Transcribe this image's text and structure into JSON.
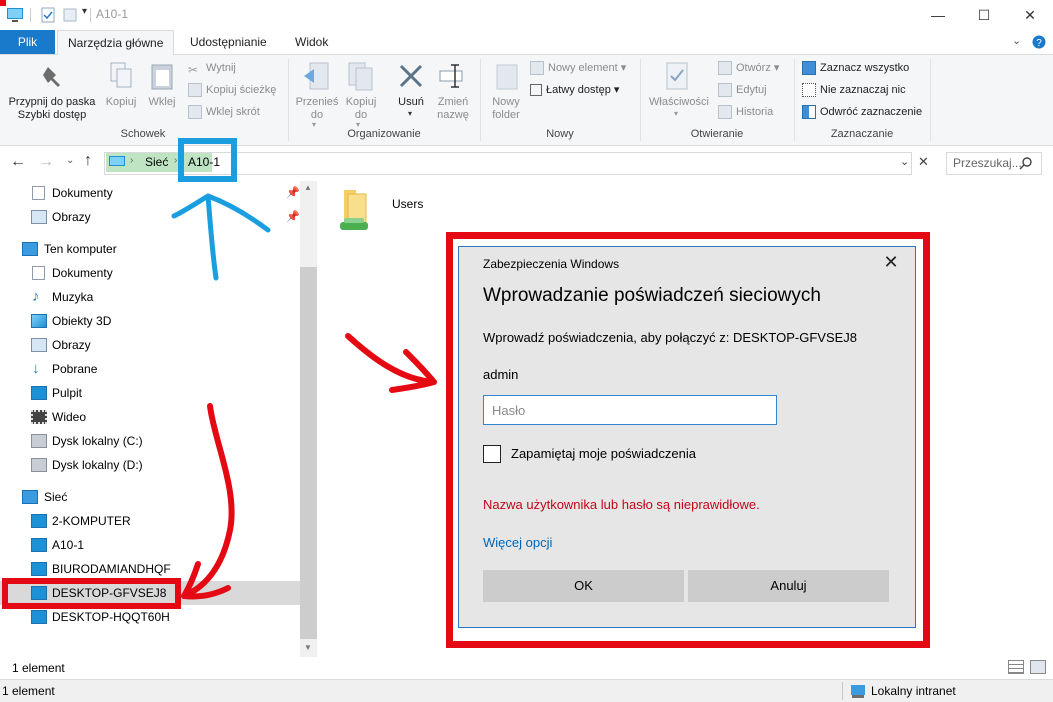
{
  "window": {
    "title": "A10-1",
    "minimize": "—",
    "maximize": "☐",
    "close": "✕"
  },
  "ribbon": {
    "tabs": [
      "Plik",
      "Narzędzia główne",
      "Udostępnianie",
      "Widok"
    ],
    "clipboard": {
      "pin_label": "Przypnij do paska Szybki dostęp",
      "copy_label": "Kopiuj",
      "paste_label": "Wklej",
      "cut_label": "Wytnij",
      "copy_path_label": "Kopiuj ścieżkę",
      "paste_shortcut_label": "Wklej skrót",
      "group_label": "Schowek"
    },
    "organize": {
      "move_label": "Przenieś do",
      "copy_to_label": "Kopiuj do",
      "delete_label": "Usuń",
      "rename_label": "Zmień nazwę",
      "group_label": "Organizowanie"
    },
    "new": {
      "new_folder_label": "Nowy folder",
      "new_item_label": "Nowy element",
      "easy_access_label": "Łatwy dostęp",
      "group_label": "Nowy"
    },
    "open": {
      "properties_label": "Właściwości",
      "open_label": "Otwórz",
      "edit_label": "Edytuj",
      "history_label": "Historia",
      "group_label": "Otwieranie"
    },
    "select": {
      "select_all_label": "Zaznacz wszystko",
      "select_none_label": "Nie zaznaczaj nic",
      "invert_label": "Odwróć zaznaczenie",
      "group_label": "Zaznaczanie"
    }
  },
  "address": {
    "crumbs": [
      "Sieć",
      "A10-1"
    ],
    "search_placeholder": "Przeszukaj..."
  },
  "nav": {
    "quick": [
      {
        "label": "Dokumenty",
        "icon": "documents-icon"
      },
      {
        "label": "Obrazy",
        "icon": "pictures-icon"
      }
    ],
    "this_pc": "Ten komputer",
    "pc_items": [
      {
        "label": "Dokumenty",
        "icon": "documents-icon"
      },
      {
        "label": "Muzyka",
        "icon": "music-icon"
      },
      {
        "label": "Obiekty 3D",
        "icon": "objects-3d-icon"
      },
      {
        "label": "Obrazy",
        "icon": "pictures-icon"
      },
      {
        "label": "Pobrane",
        "icon": "downloads-icon"
      },
      {
        "label": "Pulpit",
        "icon": "desktop-icon"
      },
      {
        "label": "Wideo",
        "icon": "video-icon"
      },
      {
        "label": "Dysk lokalny (C:)",
        "icon": "drive-icon"
      },
      {
        "label": "Dysk lokalny (D:)",
        "icon": "drive-icon"
      }
    ],
    "network": "Sieć",
    "net_items": [
      "2-KOMPUTER",
      "A10-1",
      "BIURODAMIANDHQF",
      "DESKTOP-GFVSEJ8",
      "DESKTOP-HQQT60H"
    ],
    "selected": "DESKTOP-GFVSEJ8"
  },
  "content": {
    "items": [
      {
        "label": "Users",
        "icon": "shared-folder-icon"
      }
    ]
  },
  "status": {
    "count": "1 element",
    "bottom_count": "1 element",
    "zone": "Lokalny intranet"
  },
  "dialog": {
    "title": "Zabezpieczenia Windows",
    "heading": "Wprowadzanie poświadczeń sieciowych",
    "description": "Wprowadź poświadczenia, aby połączyć z: DESKTOP-GFVSEJ8",
    "username": "admin",
    "password_placeholder": "Hasło",
    "remember_label": "Zapamiętaj moje poświadczenia",
    "error": "Nazwa użytkownika lub hasło są nieprawidłowe.",
    "more_options": "Więcej opcji",
    "ok_label": "OK",
    "cancel_label": "Anuluj",
    "close": "✕"
  },
  "colors": {
    "accent": "#1979ca",
    "annotation_red": "#e50914",
    "annotation_blue": "#1a9ee0",
    "error": "#c4061a"
  }
}
